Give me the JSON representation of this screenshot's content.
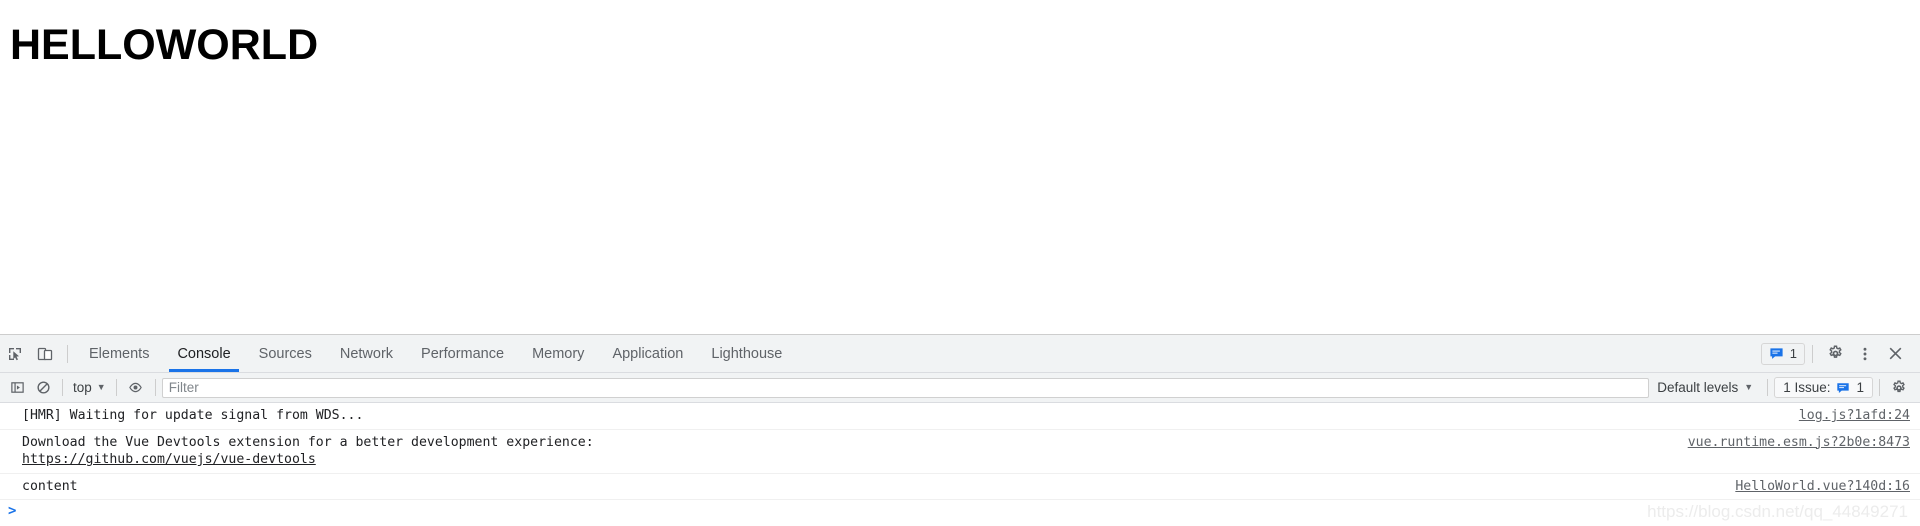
{
  "page": {
    "heading": "HELLOWORLD"
  },
  "devtools": {
    "toolbar_icons": {
      "inspect": "inspect-element-icon",
      "device": "device-toolbar-icon"
    },
    "tabs": [
      {
        "label": "Elements",
        "active": false
      },
      {
        "label": "Console",
        "active": true
      },
      {
        "label": "Sources",
        "active": false
      },
      {
        "label": "Network",
        "active": false
      },
      {
        "label": "Performance",
        "active": false
      },
      {
        "label": "Memory",
        "active": false
      },
      {
        "label": "Application",
        "active": false
      },
      {
        "label": "Lighthouse",
        "active": false
      }
    ],
    "tabbar_right": {
      "issue_count": "1",
      "settings_icon": "gear-icon",
      "more_icon": "more-vertical-icon",
      "close_icon": "close-icon"
    },
    "filterbar": {
      "sidebar_toggle_icon": "console-sidebar-icon",
      "clear_console_icon": "clear-console-icon",
      "context_label": "top",
      "eye_icon": "live-expression-icon",
      "filter_placeholder": "Filter",
      "filter_value": "",
      "levels_label": "Default levels",
      "issue_label": "1 Issue:",
      "issue_count": "1",
      "settings_icon": "settings-gear-icon"
    },
    "console": {
      "messages": [
        {
          "text": "[HMR] Waiting for update signal from WDS...",
          "link_text": "",
          "source": "log.js?1afd:24"
        },
        {
          "text": "Download the Vue Devtools extension for a better development experience:\n",
          "link_text": "https://github.com/vuejs/vue-devtools",
          "source": "vue.runtime.esm.js?2b0e:8473"
        },
        {
          "text": "content",
          "link_text": "",
          "source": "HelloWorld.vue?140d:16"
        }
      ],
      "prompt_symbol": ">",
      "prompt_value": ""
    },
    "watermark": "https://blog.csdn.net/qq_44849271"
  },
  "colors": {
    "accent": "#1a73e8",
    "toolbar_bg": "#f1f3f4",
    "text": "#202124"
  }
}
